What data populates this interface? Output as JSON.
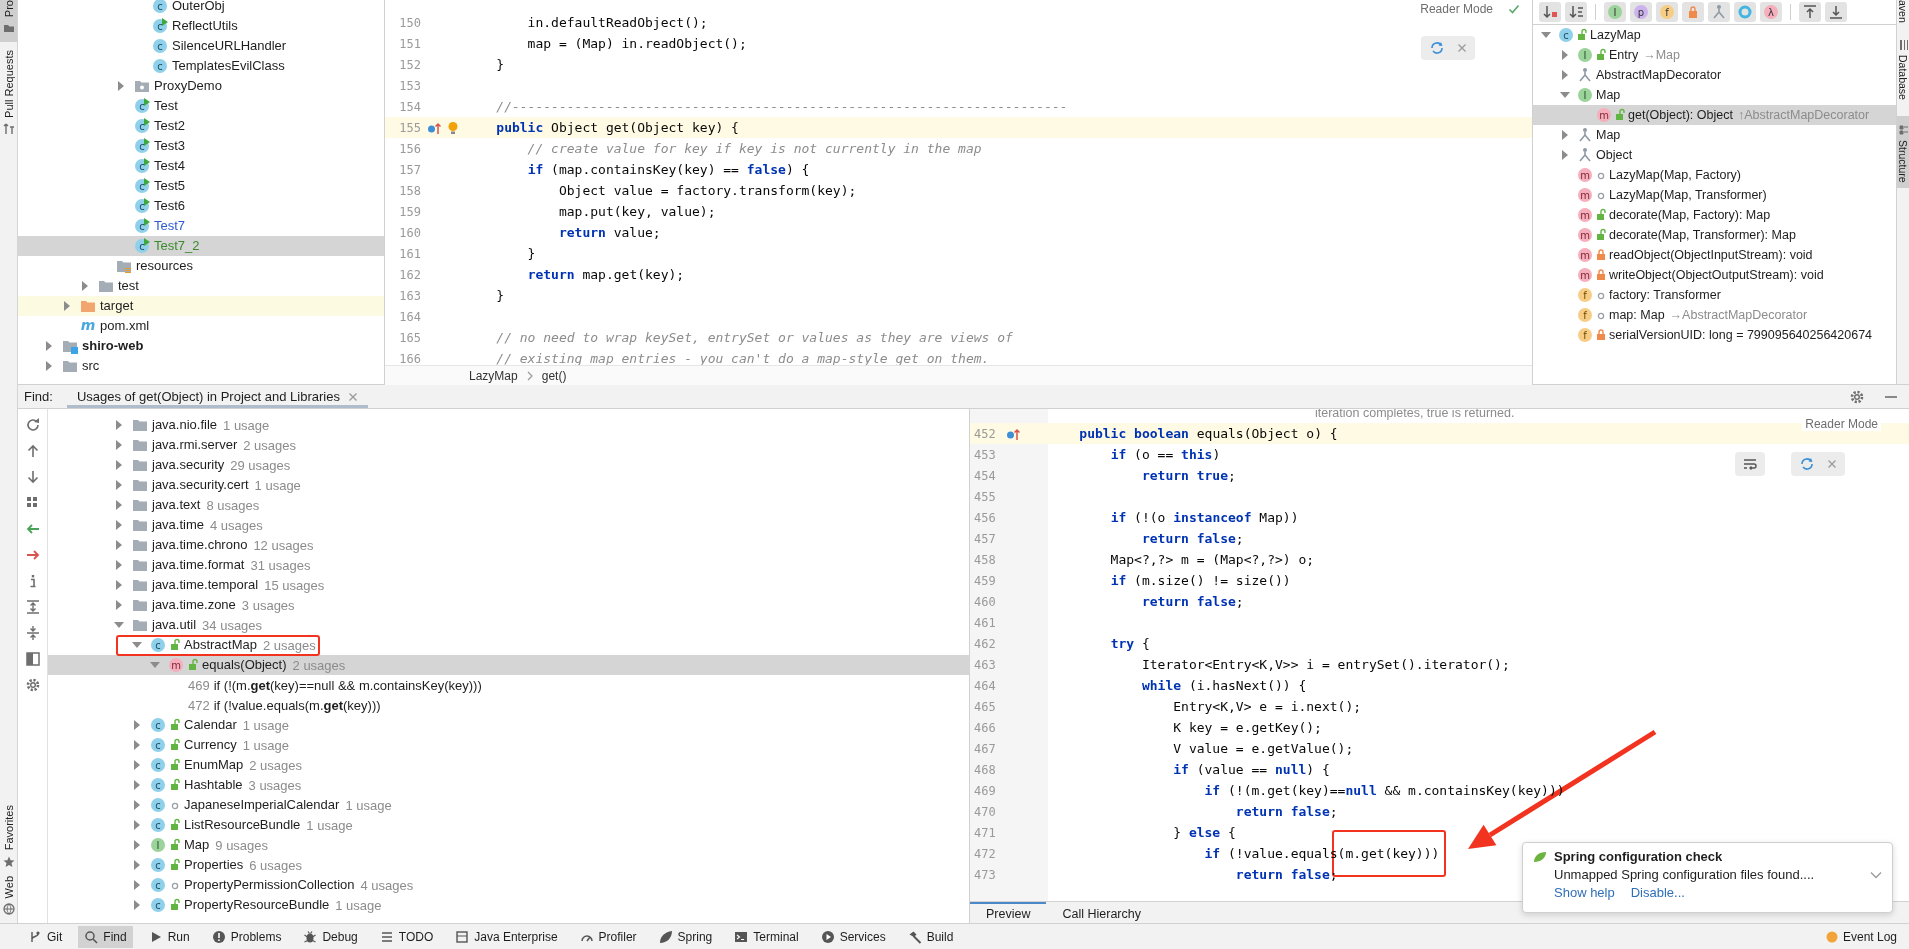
{
  "left_stripe": {
    "top_tabs": [
      {
        "label": "Pro",
        "kind": "project",
        "selected": true
      },
      {
        "label": "Pull Requests",
        "kind": "pull",
        "selected": false
      }
    ],
    "bottom_tabs": [
      {
        "label": "Favorites",
        "kind": "star"
      },
      {
        "label": "Web",
        "kind": "globe"
      }
    ]
  },
  "project_tree": {
    "items": [
      {
        "kind": "group",
        "children": [
          {
            "kind": "group",
            "children": [
              {
                "kind": "group",
                "children": [
                  {
                    "kind": "group",
                    "children": [
                      {
                        "kind": "group",
                        "children": [
                          {
                            "label": "OuterObj",
                            "kind": "class",
                            "glyph": "c",
                            "color": "#1e1e1e",
                            "selected": false
                          },
                          {
                            "label": "ReflectUtils",
                            "kind": "run_class",
                            "glyph": "c",
                            "color": "#1e1e1e",
                            "selected": false
                          },
                          {
                            "label": "SilenceURLHandler",
                            "kind": "class",
                            "glyph": "c",
                            "color": "#1e1e1e",
                            "selected": false
                          },
                          {
                            "label": "TemplatesEvilClass",
                            "kind": "class",
                            "glyph": "c",
                            "color": "#1e1e1e",
                            "selected": false
                          }
                        ]
                      },
                      {
                        "label": "ProxyDemo",
                        "kind": "package",
                        "expanded": false,
                        "color": "#1e1e1e",
                        "selected": false
                      },
                      {
                        "label": "Test",
                        "kind": "run_class",
                        "glyph": "c",
                        "color": "#1e1e1e",
                        "selected": false
                      },
                      {
                        "label": "Test2",
                        "kind": "run_class",
                        "glyph": "c",
                        "color": "#1e1e1e",
                        "selected": false
                      },
                      {
                        "label": "Test3",
                        "kind": "run_class",
                        "glyph": "c",
                        "color": "#1e1e1e",
                        "selected": false
                      },
                      {
                        "label": "Test4",
                        "kind": "run_class",
                        "glyph": "c",
                        "color": "#1e1e1e",
                        "selected": false
                      },
                      {
                        "label": "Test5",
                        "kind": "run_class",
                        "glyph": "c",
                        "color": "#1e1e1e",
                        "selected": false
                      },
                      {
                        "label": "Test6",
                        "kind": "run_class",
                        "glyph": "c",
                        "color": "#1e1e1e",
                        "selected": false
                      },
                      {
                        "label": "Test7",
                        "kind": "run_class",
                        "glyph": "c",
                        "color": "#2d5bd1",
                        "selected": false
                      },
                      {
                        "label": "Test7_2",
                        "kind": "run_class",
                        "glyph": "c",
                        "color": "#3b8a2c",
                        "selected": true
                      }
                    ]
                  },
                  {
                    "label": "resources",
                    "kind": "resources",
                    "color": "#1e1e1e",
                    "selected": false
                  }
                ]
              },
              {
                "label": "test",
                "kind": "folder",
                "expanded": false,
                "color": "#1e1e1e",
                "selected": false
              }
            ]
          },
          {
            "label": "target",
            "kind": "excluded",
            "expanded": false,
            "color": "#1e1e1e",
            "selected": false
          },
          {
            "label": "pom.xml",
            "kind": "maven",
            "glyph": "m",
            "color": "#1e1e1e",
            "selected": false
          }
        ]
      },
      {
        "label": "shiro-web",
        "kind": "module",
        "expanded": false,
        "color": "#1e1e1e",
        "selected": false
      },
      {
        "label": "src",
        "kind": "folder",
        "expanded": false,
        "selected": false
      }
    ]
  },
  "editor": {
    "reader_mode": "Reader Mode",
    "intention_bulb": true,
    "lines": [
      {
        "num": "150",
        "kind": "code",
        "text": "        in.defaultReadObject();"
      },
      {
        "num": "151",
        "kind": "code",
        "text": "        map = (Map) in.readObject();"
      },
      {
        "num": "152",
        "kind": "code",
        "text": "    }"
      },
      {
        "num": "153",
        "kind": "code"
      },
      {
        "num": "154",
        "kind": "comment",
        "text": "    //-----------------------------------------------------------------------"
      },
      {
        "num": "155",
        "kind": "declaration",
        "text": "    **public** Object get(Object key) {"
      },
      {
        "num": "156",
        "kind": "comment",
        "text": "        // create value for key if key is not currently in the map"
      },
      {
        "num": "157",
        "kind": "code",
        "text": "        **if** (map.containsKey(key) == **false**) {"
      },
      {
        "num": "158",
        "kind": "code",
        "text": "            Object value = factory.transform(key);"
      },
      {
        "num": "159",
        "kind": "code",
        "text": "            map.put(key, value);"
      },
      {
        "num": "160",
        "kind": "code",
        "text": "            **return** value;"
      },
      {
        "num": "161",
        "kind": "code",
        "text": "        }"
      },
      {
        "num": "162",
        "kind": "code",
        "text": "        **return** map.get(key);"
      },
      {
        "num": "163",
        "kind": "code",
        "text": "    }"
      },
      {
        "num": "164",
        "kind": "code"
      },
      {
        "num": "165",
        "kind": "comment",
        "text": "    // no need to wrap keySet, entrySet or values as they are views of"
      },
      {
        "num": "166",
        "kind": "comment",
        "text": "    // existing map entries - you can't do a map-style get on them."
      }
    ],
    "breadcrumbs": [
      "LazyMap",
      "get()"
    ]
  },
  "structure": {
    "toolbar_groups": [
      [
        {
          "kind": "sort_visibility"
        },
        {
          "kind": "sort_alpha"
        }
      ],
      [
        {
          "kind": "badge",
          "glyph": "I",
          "color": "#9bd39b"
        },
        {
          "kind": "badge",
          "glyph": "p",
          "color": "#cdb3ee"
        },
        {
          "kind": "badge",
          "glyph": "f",
          "color": "#f7cd86"
        },
        {
          "kind": "lock"
        },
        {
          "kind": "hierarchy"
        },
        {
          "kind": "ring"
        },
        {
          "kind": "badge",
          "glyph": "λ",
          "color": "#f5aebb"
        }
      ],
      [
        {
          "kind": "expand"
        },
        {
          "kind": "collapse"
        }
      ]
    ],
    "tree": [
      {
        "label": "LazyMap",
        "kind": "class",
        "glyph": "c",
        "access": {
          "kind": "public"
        },
        "expanded": true,
        "selected": false,
        "children": [
          {
            "label": "Entry",
            "suffix": "→Map",
            "kind": "interface",
            "glyph": "I",
            "access": {
              "kind": "public"
            },
            "expanded": false,
            "selected": false
          },
          {
            "label": "AbstractMapDecorator",
            "kind": "inherited",
            "expanded": false,
            "selected": false
          },
          {
            "label": "Map",
            "kind": "interface",
            "glyph": "I",
            "expanded": true,
            "selected": false,
            "children": [
              {
                "label": "get(Object): Object",
                "suffix": "↑AbstractMapDecorator",
                "kind": "method",
                "glyph": "m",
                "access": {
                  "kind": "public"
                },
                "selected": true
              }
            ]
          },
          {
            "label": "Map",
            "kind": "inherited",
            "expanded": false,
            "selected": false
          },
          {
            "label": "Object",
            "kind": "inherited",
            "expanded": false,
            "selected": false
          },
          {
            "label": "LazyMap(Map, Factory)",
            "kind": "method",
            "glyph": "m",
            "access": {
              "kind": "package"
            },
            "selected": false
          },
          {
            "label": "LazyMap(Map, Transformer)",
            "kind": "method",
            "glyph": "m",
            "access": {
              "kind": "package"
            },
            "selected": false
          },
          {
            "label": "decorate(Map, Factory): Map",
            "kind": "method",
            "glyph": "m",
            "access": {
              "kind": "public"
            },
            "selected": false
          },
          {
            "label": "decorate(Map, Transformer): Map",
            "kind": "method",
            "glyph": "m",
            "access": {
              "kind": "public"
            },
            "selected": false
          },
          {
            "label": "readObject(ObjectInputStream): void",
            "kind": "method",
            "glyph": "m",
            "access": {
              "kind": "private"
            },
            "selected": false
          },
          {
            "label": "writeObject(ObjectOutputStream): void",
            "kind": "method",
            "glyph": "m",
            "access": {
              "kind": "private"
            },
            "selected": false
          },
          {
            "label": "factory: Transformer",
            "kind": "field",
            "glyph": "f",
            "access": {
              "kind": "package"
            },
            "selected": false
          },
          {
            "label": "map: Map",
            "suffix": "→AbstractMapDecorator",
            "kind": "field",
            "glyph": "f",
            "access": {
              "kind": "package"
            },
            "selected": false
          },
          {
            "label": "serialVersionUID: long = 799095640256420674",
            "kind": "field",
            "glyph": "f",
            "access": {
              "kind": "private"
            },
            "selected": false
          }
        ]
      }
    ]
  },
  "right_stripe": {
    "tabs": [
      {
        "label": "aven",
        "kind": "plain",
        "selected": false
      },
      {
        "label": "Database",
        "kind": "database",
        "selected": false
      },
      {
        "label": "Structure",
        "kind": "structure",
        "selected": true
      }
    ]
  },
  "find": {
    "label": "Find:",
    "tabs": [
      {
        "label": "Usages of get(Object) in Project and Libraries",
        "selected": true
      }
    ],
    "tree": [
      {
        "label": "java.nio.file",
        "count": "1 usage",
        "kind": "folder",
        "expanded": false,
        "selected": false
      },
      {
        "label": "java.rmi.server",
        "count": "2 usages",
        "kind": "folder",
        "expanded": false,
        "selected": false
      },
      {
        "label": "java.security",
        "count": "29 usages",
        "kind": "folder",
        "expanded": false,
        "selected": false
      },
      {
        "label": "java.security.cert",
        "count": "1 usage",
        "kind": "folder",
        "expanded": false,
        "selected": false
      },
      {
        "label": "java.text",
        "count": "8 usages",
        "kind": "folder",
        "expanded": false,
        "selected": false
      },
      {
        "label": "java.time",
        "count": "4 usages",
        "kind": "folder",
        "expanded": false,
        "selected": false
      },
      {
        "label": "java.time.chrono",
        "count": "12 usages",
        "kind": "folder",
        "expanded": false,
        "selected": false
      },
      {
        "label": "java.time.format",
        "count": "31 usages",
        "kind": "folder",
        "expanded": false,
        "selected": false
      },
      {
        "label": "java.time.temporal",
        "count": "15 usages",
        "kind": "folder",
        "expanded": false,
        "selected": false
      },
      {
        "label": "java.time.zone",
        "count": "3 usages",
        "kind": "folder",
        "expanded": false,
        "selected": false
      },
      {
        "label": "java.util",
        "count": "34 usages",
        "kind": "folder",
        "expanded": true,
        "selected": false,
        "children": [
          {
            "label": "AbstractMap",
            "count": "2 usages",
            "kind": "class",
            "glyph": "c",
            "access": {
              "kind": "public"
            },
            "expanded": true,
            "selected": false,
            "boxed": true,
            "children": [
              {
                "label": "equals(Object)",
                "count": "2 usages",
                "kind": "method",
                "glyph": "m",
                "access": {
                  "kind": "public"
                },
                "expanded": true,
                "selected": true,
                "children": [
                  {
                    "kind": "usage",
                    "line": "469",
                    "text": "if (!(m.**get**(key)==null && m.containsKey(key)))",
                    "selected": false
                  },
                  {
                    "kind": "usage",
                    "line": "472",
                    "text": "if (!value.equals(m.**get**(key)))",
                    "selected": false
                  }
                ]
              }
            ]
          },
          {
            "label": "Calendar",
            "count": "1 usage",
            "kind": "class",
            "glyph": "c",
            "access": {
              "kind": "public"
            },
            "expanded": false,
            "selected": false,
            "boxed": false
          },
          {
            "label": "Currency",
            "count": "1 usage",
            "kind": "class",
            "glyph": "c",
            "access": {
              "kind": "public"
            },
            "expanded": false,
            "selected": false,
            "boxed": false
          },
          {
            "label": "EnumMap",
            "count": "2 usages",
            "kind": "class",
            "glyph": "c",
            "access": {
              "kind": "public"
            },
            "expanded": false,
            "selected": false,
            "boxed": false
          },
          {
            "label": "Hashtable",
            "count": "3 usages",
            "kind": "class",
            "glyph": "c",
            "access": {
              "kind": "public"
            },
            "expanded": false,
            "selected": false,
            "boxed": false
          },
          {
            "label": "JapaneseImperialCalendar",
            "count": "1 usage",
            "kind": "class",
            "glyph": "c",
            "access": {
              "kind": "package"
            },
            "expanded": false,
            "selected": false,
            "boxed": false
          },
          {
            "label": "ListResourceBundle",
            "count": "1 usage",
            "kind": "class",
            "glyph": "c",
            "access": {
              "kind": "public"
            },
            "expanded": false,
            "selected": false,
            "boxed": false
          },
          {
            "label": "Map",
            "count": "9 usages",
            "kind": "interface",
            "glyph": "I",
            "access": {
              "kind": "public"
            },
            "expanded": false,
            "selected": false,
            "boxed": false
          },
          {
            "label": "Properties",
            "count": "6 usages",
            "kind": "class",
            "glyph": "c",
            "access": {
              "kind": "public"
            },
            "expanded": false,
            "selected": false,
            "boxed": false
          },
          {
            "label": "PropertyPermissionCollection",
            "count": "4 usages",
            "kind": "class",
            "glyph": "c",
            "access": {
              "kind": "package"
            },
            "expanded": false,
            "selected": false,
            "boxed": false
          },
          {
            "label": "PropertyResourceBundle",
            "count": "1 usage",
            "kind": "class",
            "glyph": "c",
            "access": {
              "kind": "public"
            },
            "expanded": false,
            "selected": false,
            "boxed": false
          }
        ]
      }
    ]
  },
  "preview": {
    "doc_text": "iteration completes, true is returned.",
    "reader_mode": "Reader Mode",
    "lines": [
      {
        "num": "452",
        "kind": "declaration",
        "text": "    **public** **boolean** equals(Object o) {"
      },
      {
        "num": "453",
        "kind": "code",
        "text": "        **if** (o == **this**)"
      },
      {
        "num": "454",
        "kind": "code",
        "text": "            **return** **true**;"
      },
      {
        "num": "455",
        "kind": "code"
      },
      {
        "num": "456",
        "kind": "code",
        "text": "        **if** (!(o **instanceof** Map))"
      },
      {
        "num": "457",
        "kind": "code",
        "text": "            **return** **false**;"
      },
      {
        "num": "458",
        "kind": "code",
        "text": "        Map<?,?> m = (Map<?,?>) o;"
      },
      {
        "num": "459",
        "kind": "code",
        "text": "        **if** (m.size() != size())"
      },
      {
        "num": "460",
        "kind": "code",
        "text": "            **return** **false**;"
      },
      {
        "num": "461",
        "kind": "code"
      },
      {
        "num": "462",
        "kind": "code",
        "text": "        **try** {"
      },
      {
        "num": "463",
        "kind": "code",
        "text": "            Iterator<Entry<K,V>> i = entrySet().iterator();"
      },
      {
        "num": "464",
        "kind": "code",
        "text": "            **while** (i.hasNext()) {"
      },
      {
        "num": "465",
        "kind": "code",
        "text": "                Entry<K,V> e = i.next();"
      },
      {
        "num": "466",
        "kind": "code",
        "text": "                K key = e.getKey();"
      },
      {
        "num": "467",
        "kind": "code",
        "text": "                V value = e.getValue();"
      },
      {
        "num": "468",
        "kind": "code",
        "text": "                **if** (value == **null**) {"
      },
      {
        "num": "469",
        "kind": "code",
        "text": "                    **if** (!(m.get(key)==**null** && m.containsKey(key)))"
      },
      {
        "num": "470",
        "kind": "code",
        "text": "                        **return** **false**;"
      },
      {
        "num": "471",
        "kind": "code",
        "text": "                } **else** {"
      },
      {
        "num": "472",
        "kind": "code",
        "text": "                    **if** (!value.equals(m.get(key)))"
      },
      {
        "num": "473",
        "kind": "code",
        "text": "                        **return** **false**;"
      }
    ],
    "tabs": [
      {
        "label": "Preview",
        "selected": true
      },
      {
        "label": "Call Hierarchy",
        "selected": false
      }
    ]
  },
  "notification": {
    "title": "Spring configuration check",
    "message": "Unmapped Spring configuration files found....",
    "actions": [
      "Show help",
      "Disable..."
    ]
  },
  "status_bar": {
    "items": [
      {
        "label": "Git",
        "kind": "git",
        "selected": false
      },
      {
        "label": "Find",
        "kind": "find",
        "selected": true
      },
      {
        "label": "Run",
        "kind": "run",
        "selected": false
      },
      {
        "label": "Problems",
        "kind": "problems",
        "selected": false
      },
      {
        "label": "Debug",
        "kind": "debug",
        "selected": false
      },
      {
        "label": "TODO",
        "kind": "todo",
        "selected": false
      },
      {
        "label": "Java Enterprise",
        "kind": "enterprise",
        "selected": false
      },
      {
        "label": "Profiler",
        "kind": "profiler",
        "selected": false
      },
      {
        "label": "Spring",
        "kind": "spring",
        "selected": false
      },
      {
        "label": "Terminal",
        "kind": "terminal",
        "selected": false
      },
      {
        "label": "Services",
        "kind": "services",
        "selected": false
      },
      {
        "label": "Build",
        "kind": "build",
        "selected": false
      }
    ],
    "event_log": "Event Log"
  }
}
